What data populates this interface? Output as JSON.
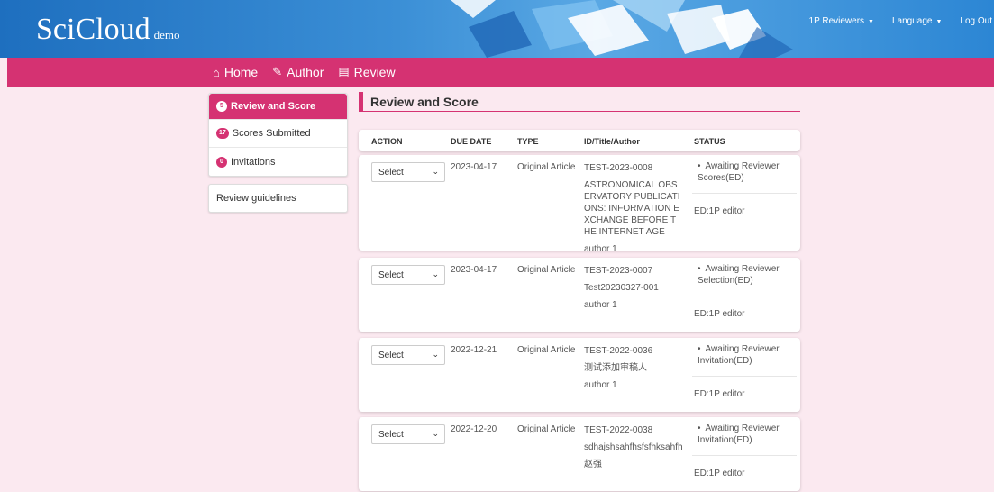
{
  "brand": {
    "name": "SciCloud",
    "sub": "demo"
  },
  "topnav": {
    "reviewers": "1P Reviewers",
    "language": "Language",
    "logout": "Log Out"
  },
  "nav": {
    "home": "Home",
    "author": "Author",
    "review": "Review"
  },
  "sidebar": {
    "items": [
      {
        "badge": "5",
        "label": "Review and Score"
      },
      {
        "badge": "17",
        "label": "Scores Submitted"
      },
      {
        "badge": "0",
        "label": "Invitations"
      }
    ],
    "guidelines": "Review guidelines"
  },
  "main": {
    "title": "Review and Score",
    "columns": {
      "action": "ACTION",
      "due": "DUE DATE",
      "type": "TYPE",
      "id": "ID/Title/Author",
      "status": "STATUS"
    },
    "rows": [
      {
        "select": "Select",
        "due": "2023-04-17",
        "type": "Original Article",
        "id": "TEST-2023-0008",
        "title": "ASTRONOMICAL OBSERVATORY PUBLICATIONS: INFORMATION EXCHANGE BEFORE THE INTERNET AGE",
        "author": "author 1",
        "status": "Awaiting Reviewer Scores(ED)",
        "editor": "ED:1P editor"
      },
      {
        "select": "Select",
        "due": "2023-04-17",
        "type": "Original Article",
        "id": "TEST-2023-0007",
        "title": "Test20230327-001",
        "author": "author 1",
        "status": "Awaiting Reviewer Selection(ED)",
        "editor": "ED:1P editor"
      },
      {
        "select": "Select",
        "due": "2022-12-21",
        "type": "Original Article",
        "id": "TEST-2022-0036",
        "title": "测试添加审稿人",
        "author": "author 1",
        "status": "Awaiting Reviewer Invitation(ED)",
        "editor": "ED:1P editor"
      },
      {
        "select": "Select",
        "due": "2022-12-20",
        "type": "Original Article",
        "id": "TEST-2022-0038",
        "title": "sdhajshsahfhsfsfhksahfh",
        "author": "赵强",
        "status": "Awaiting Reviewer Invitation(ED)",
        "editor": "ED:1P editor"
      }
    ]
  }
}
